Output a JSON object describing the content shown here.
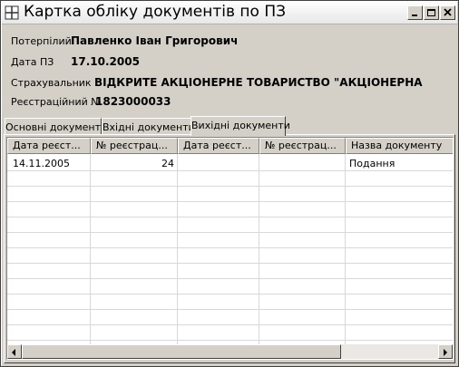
{
  "window": {
    "title": "Картка обліку документів по ПЗ"
  },
  "fields": {
    "victim_label": "Потерпілий",
    "victim_value": "Павленко Іван Григорович",
    "date_label": "Дата ПЗ",
    "date_value": "17.10.2005",
    "insurer_label": "Страхувальник",
    "insurer_value": "ВІДКРИТЕ АКЦІОНЕРНЕ ТОВАРИСТВО  \"АКЦІОНЕРНА",
    "regnum_label": "Реєстраційний №",
    "regnum_value": "1823000033"
  },
  "tabs": [
    {
      "label": "Основні документи"
    },
    {
      "label": "Вхідні документи"
    },
    {
      "label": "Вихідні документи"
    }
  ],
  "active_tab": "Вихідні документи",
  "table": {
    "columns": [
      "Дата реєст...",
      "№ реєстрац...",
      "Дата реєст...",
      "№ реєстрац...",
      "Назва документу"
    ],
    "rows": [
      [
        "14.11.2005",
        "24",
        "",
        "",
        "Подання"
      ]
    ]
  },
  "icons": {
    "app": "grid-icon",
    "minimize": "minimize-icon",
    "maximize": "maximize-icon",
    "close": "close-icon",
    "scroll_left": "arrow-left-icon",
    "scroll_right": "arrow-right-icon"
  }
}
